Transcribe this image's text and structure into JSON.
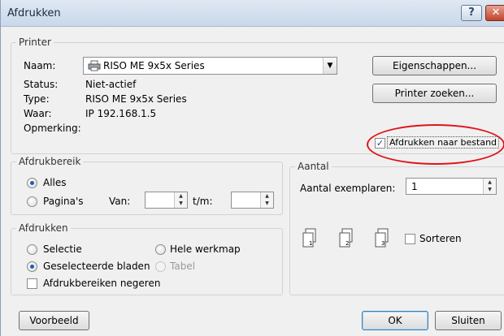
{
  "window": {
    "title": "Afdrukken"
  },
  "printer": {
    "group_label": "Printer",
    "name_label": "Naam:",
    "name_value": "RISO ME 9x5x Series",
    "status_label": "Status:",
    "status_value": "Niet-actief",
    "type_label": "Type:",
    "type_value": "RISO ME 9x5x Series",
    "where_label": "Waar:",
    "where_value": "IP 192.168.1.5",
    "comment_label": "Opmerking:",
    "properties_button": "Eigenschappen...",
    "find_button": "Printer zoeken...",
    "print_to_file_label": "Afdrukken naar bestand"
  },
  "range": {
    "group_label": "Afdrukbereik",
    "all_label": "Alles",
    "pages_label": "Pagina's",
    "from_label": "Van:",
    "to_label": "t/m:"
  },
  "print_what": {
    "group_label": "Afdrukken",
    "selection_label": "Selectie",
    "whole_workbook_label": "Hele werkmap",
    "selected_sheets_label": "Geselecteerde bladen",
    "table_label": "Tabel",
    "ignore_areas_label": "Afdrukbereiken negeren"
  },
  "copies": {
    "group_label": "Aantal",
    "copies_label": "Aantal exemplaren:",
    "copies_value": "1",
    "collate_label": "Sorteren"
  },
  "footer": {
    "preview_button": "Voorbeeld",
    "ok_button": "OK",
    "close_button": "Sluiten"
  },
  "colors": {
    "highlight": "#e0141a",
    "accent": "#1a5fb4"
  }
}
